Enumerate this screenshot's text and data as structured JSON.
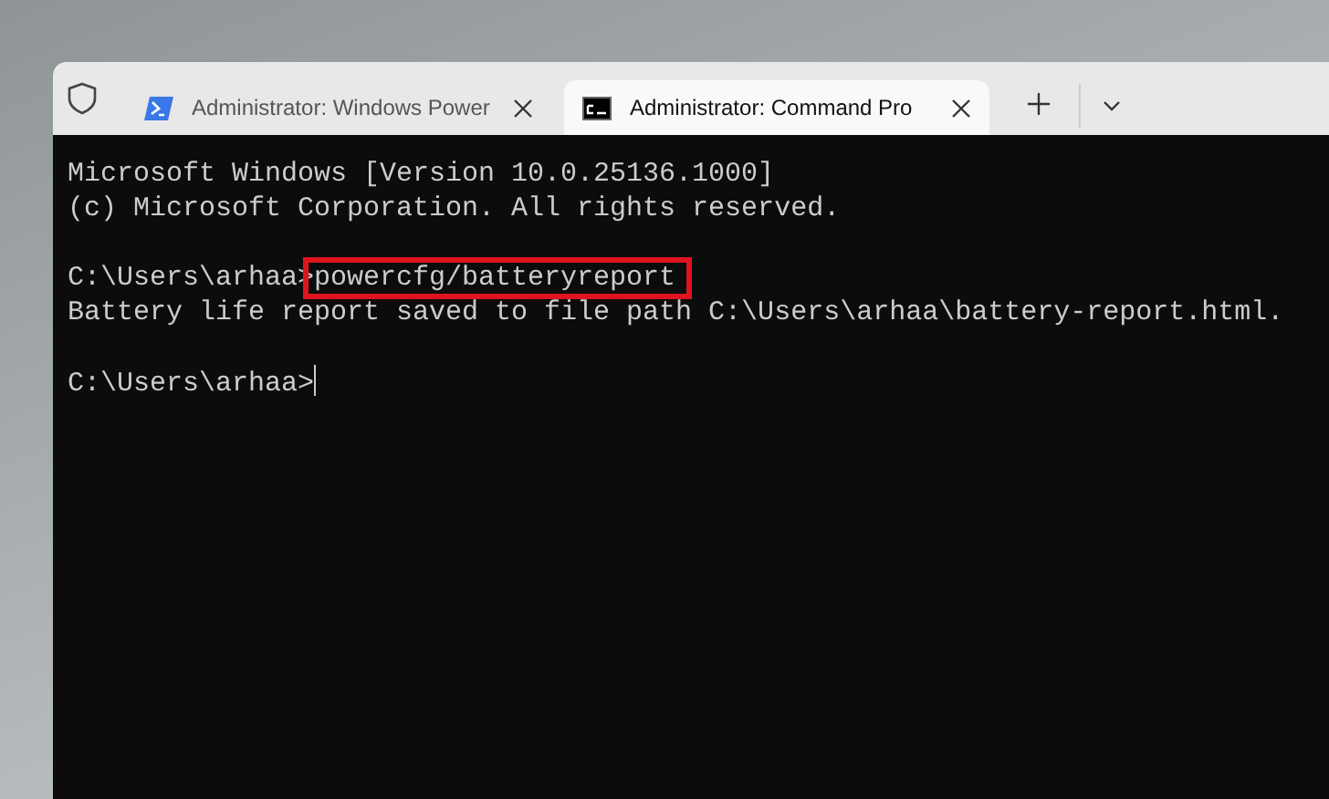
{
  "tabs": [
    {
      "kind": "powershell",
      "label": "Administrator: Windows Power",
      "selected": false
    },
    {
      "kind": "cmd",
      "label": "Administrator: Command Pro",
      "selected": true
    }
  ],
  "terminal": {
    "lines": [
      {
        "kind": "output",
        "text": "Microsoft Windows [Version 10.0.25136.1000]"
      },
      {
        "kind": "output",
        "text": "(c) Microsoft Corporation. All rights reserved."
      },
      {
        "kind": "blank"
      },
      {
        "kind": "prompt",
        "prompt": "C:\\Users\\arhaa>",
        "command": "powercfg/batteryreport",
        "highlighted": true
      },
      {
        "kind": "output",
        "text": "Battery life report saved to file path C:\\Users\\arhaa\\battery-report.html."
      },
      {
        "kind": "blank"
      },
      {
        "kind": "prompt",
        "prompt": "C:\\Users\\arhaa>",
        "cursor": true
      }
    ]
  }
}
